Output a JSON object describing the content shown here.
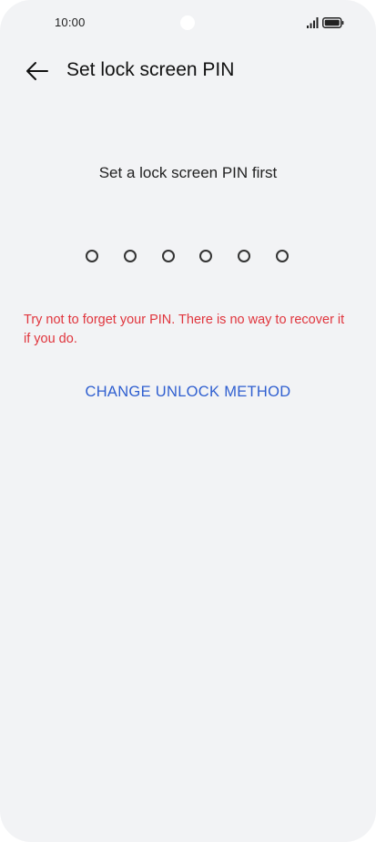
{
  "status_bar": {
    "time": "10:00",
    "signal_icon": "cellular-signal-icon",
    "battery_icon": "battery-icon"
  },
  "header": {
    "back_icon": "back-arrow-icon",
    "title": "Set lock screen PIN"
  },
  "pin_entry": {
    "prompt": "Set a lock screen PIN first",
    "digits_total": 6,
    "digits_entered": 0
  },
  "warning": {
    "text": "Try not to forget your PIN. There is no way to recover it if you do."
  },
  "actions": {
    "change_unlock_method": "CHANGE UNLOCK METHOD"
  },
  "colors": {
    "background": "#f2f3f5",
    "warning": "#e0353d",
    "accent": "#2f5fd0"
  }
}
